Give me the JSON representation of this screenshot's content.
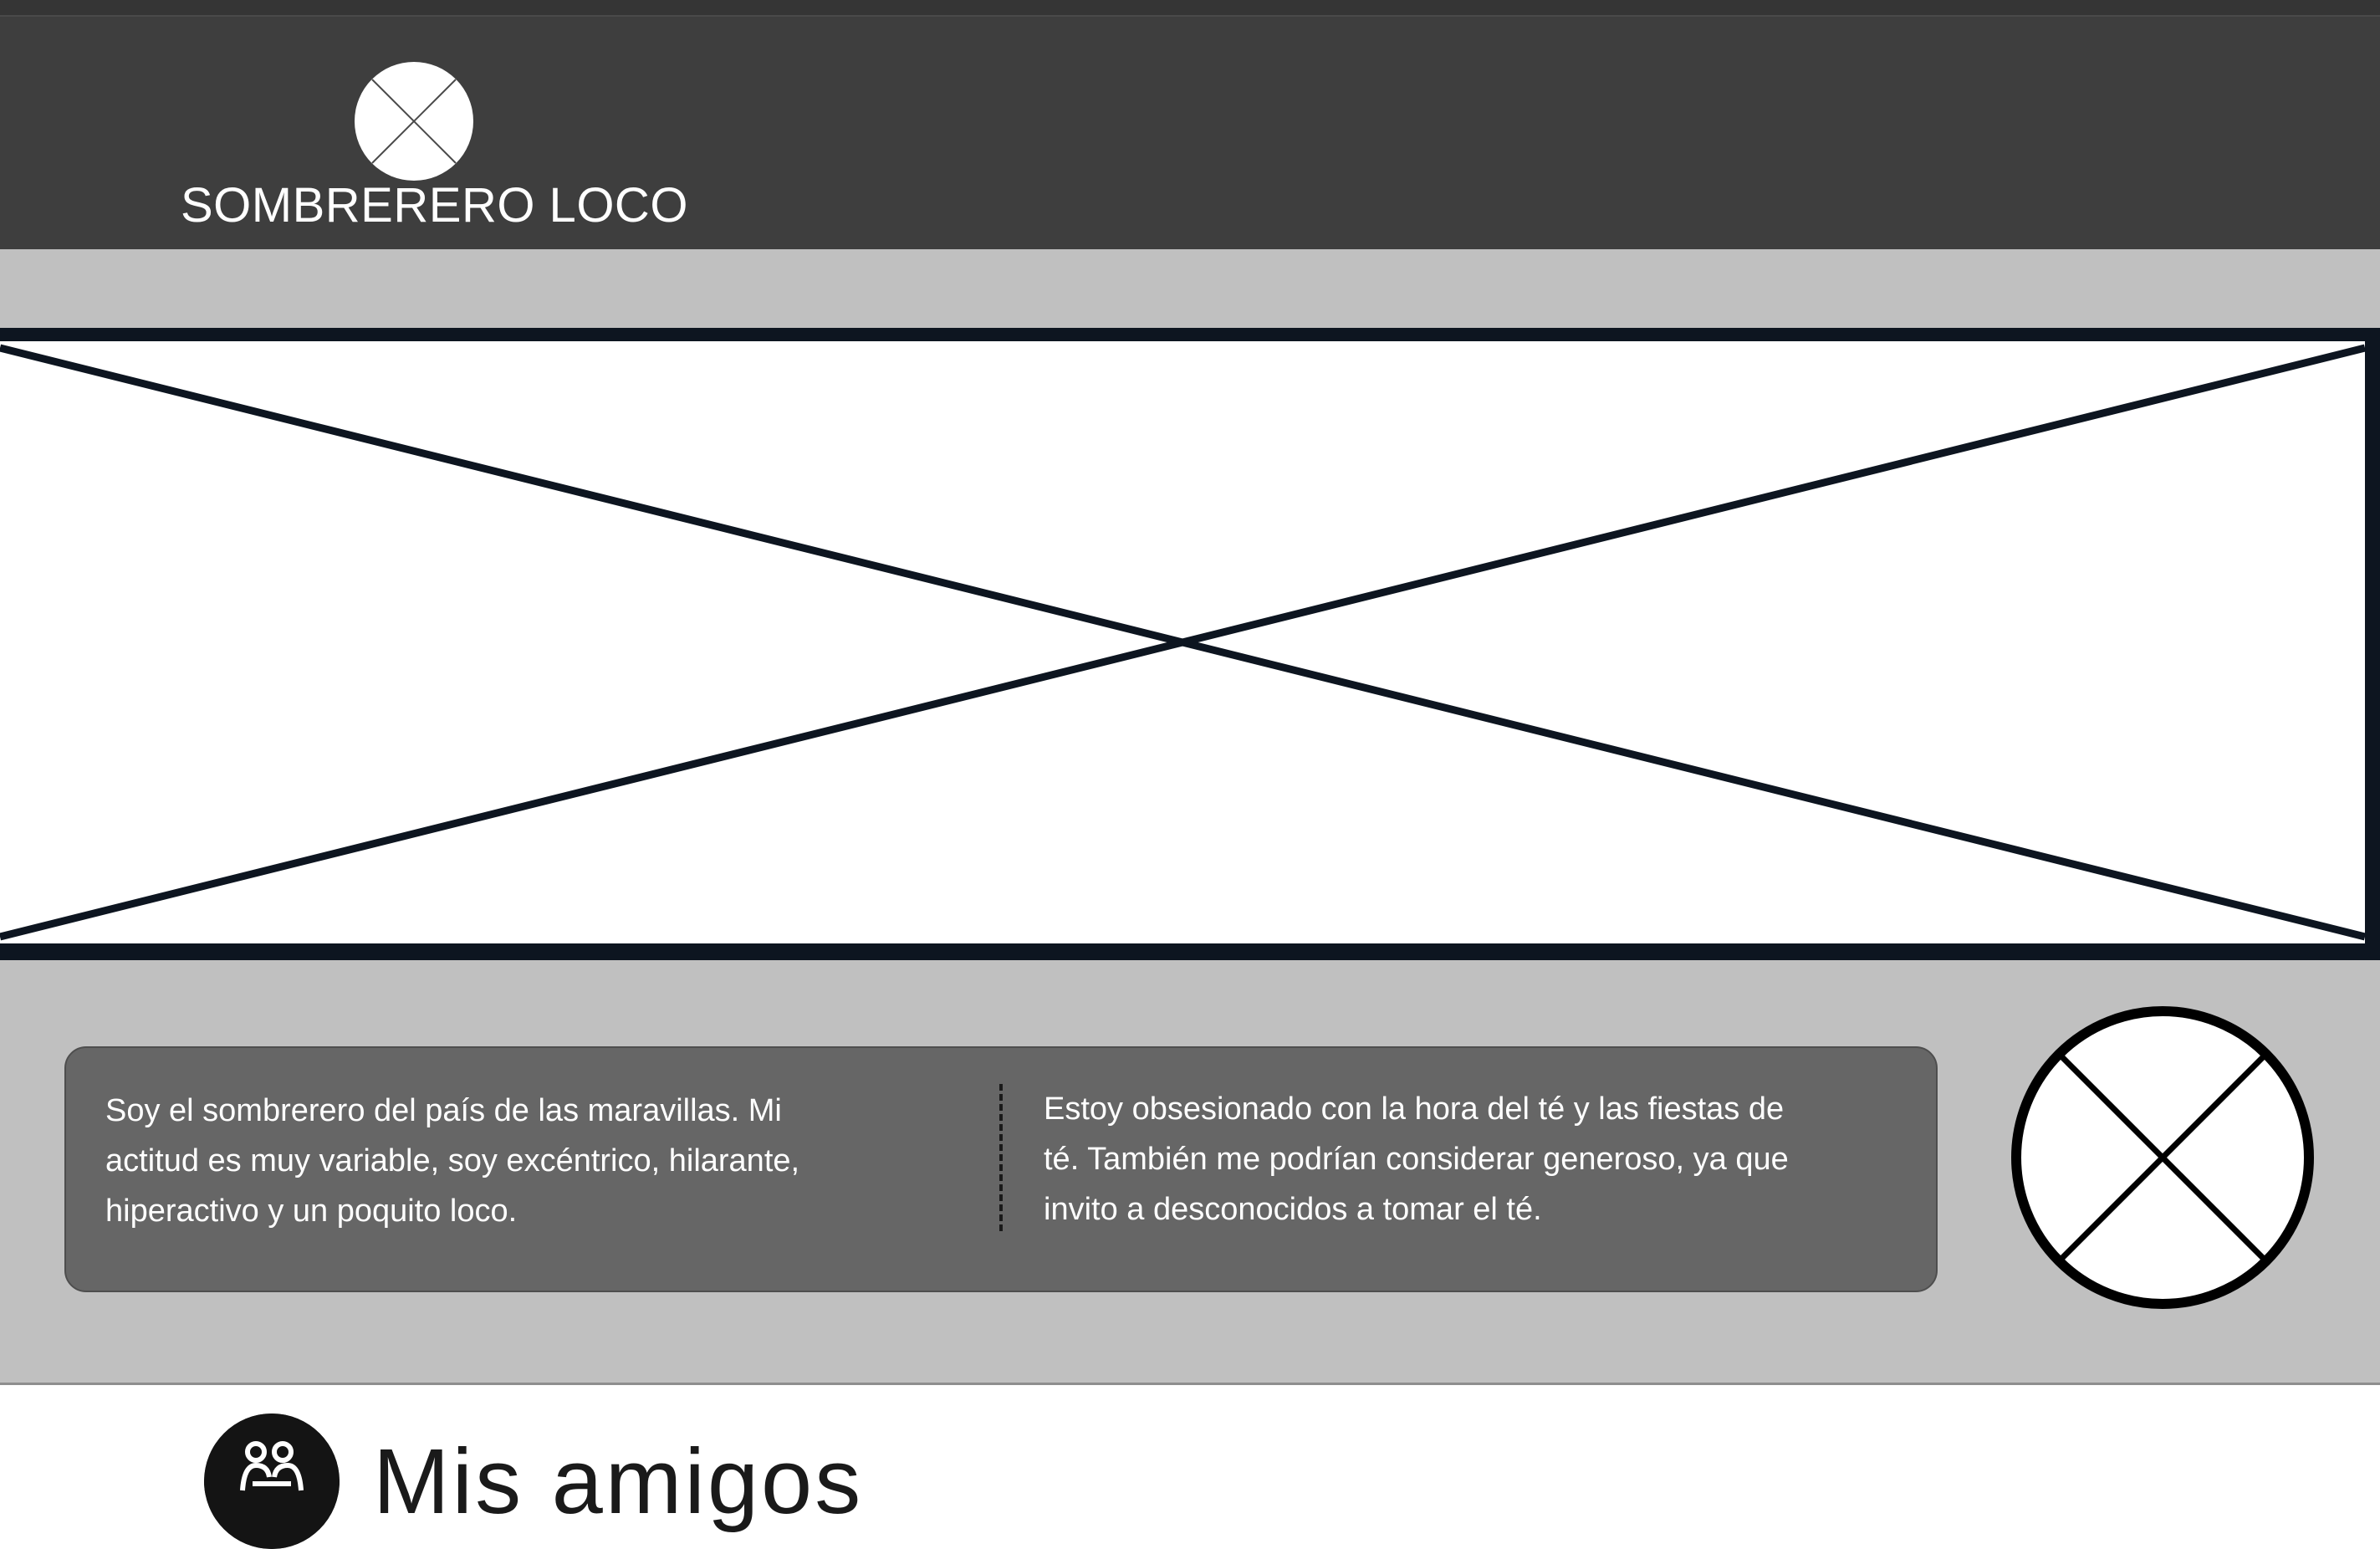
{
  "header": {
    "brand": "SOMBRERERO LOCO",
    "logo_icon": "image-placeholder-icon"
  },
  "hero": {
    "icon": "image-placeholder-icon"
  },
  "about": {
    "left_text": "Soy el sombrerero del país de las maravillas. Mi actitud es muy variable, soy excéntrico, hilarante, hiperactivo y un poquito loco.",
    "right_text": "Estoy obsesionado con la hora del té y las fiestas de té. También me podrían considerar generoso, ya que invito a desconocidos a tomar el té.",
    "side_image_icon": "image-placeholder-icon"
  },
  "friends": {
    "title": "Mis amigos",
    "icon": "friends-icon"
  },
  "colors": {
    "header_bg": "#3e3e3e",
    "band_bg": "#c0c0c0",
    "card_bg": "#666666",
    "placeholder_stroke": "#0d1520"
  }
}
